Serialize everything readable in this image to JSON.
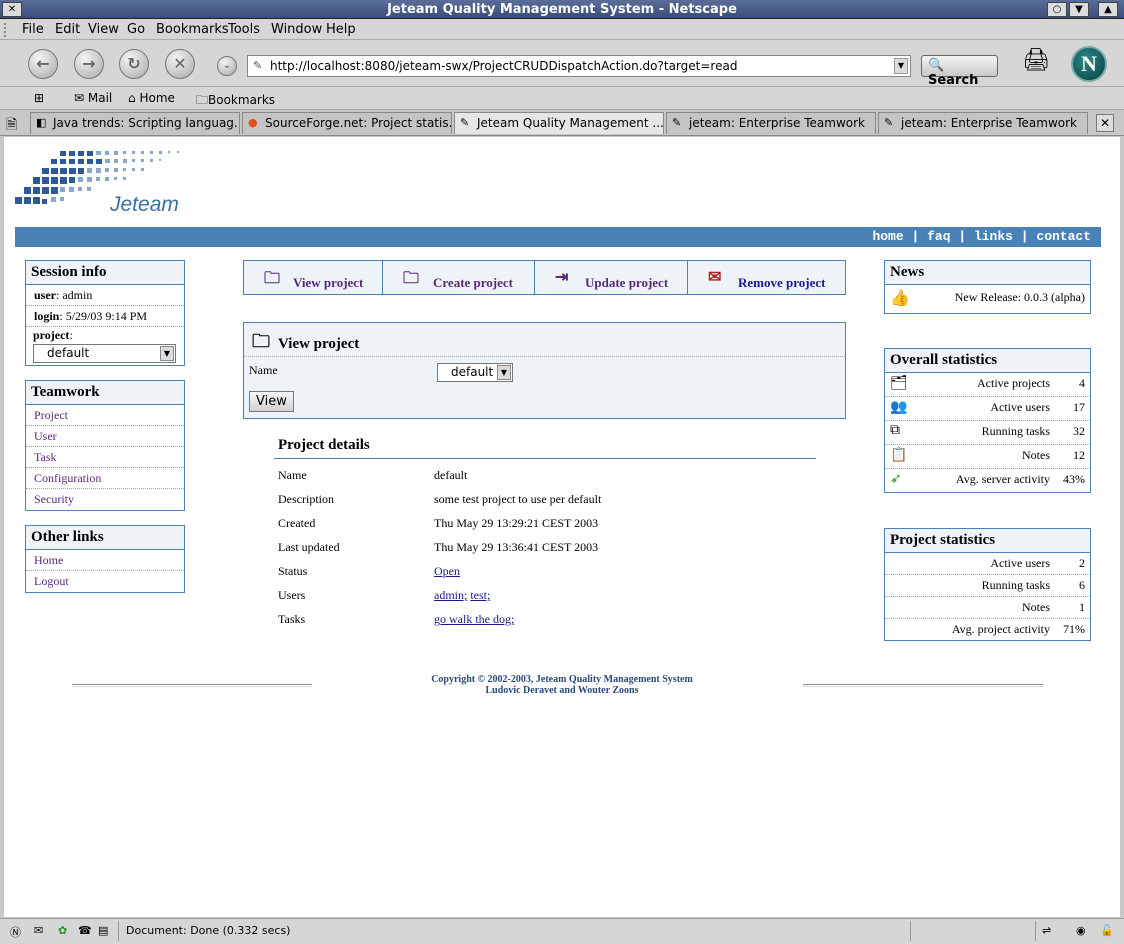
{
  "window": {
    "title": "Jeteam Quality Management System - Netscape"
  },
  "menu": [
    "File",
    "Edit",
    "View",
    "Go",
    "Bookmarks",
    "Tools",
    "Window",
    "Help"
  ],
  "navbar": {
    "url": "http://localhost:8080/jeteam-swx/ProjectCRUDDispatchAction.do?target=read",
    "search_label": "Search"
  },
  "personal_bar": {
    "mail": "Mail",
    "home": "Home",
    "bookmarks": "Bookmarks"
  },
  "tabs": [
    {
      "label": "Java trends: Scripting languag...",
      "active": false
    },
    {
      "label": "SourceForge.net: Project statis...",
      "active": false
    },
    {
      "label": "Jeteam Quality Management ...",
      "active": true
    },
    {
      "label": "jeteam: Enterprise Teamwork",
      "active": false
    },
    {
      "label": "jeteam: Enterprise Teamwork",
      "active": false
    }
  ],
  "logo": {
    "brand": "Jeteam"
  },
  "topnav": {
    "home": "home",
    "faq": "faq",
    "links": "links",
    "contact": "contact",
    "sep": "|"
  },
  "session": {
    "title": "Session info",
    "user_label": "user",
    "user_value": "admin",
    "login_label": "login",
    "login_value": "5/29/03 9:14 PM",
    "project_label": "project",
    "project_value": "default"
  },
  "teamwork": {
    "title": "Teamwork",
    "items": [
      "Project",
      "User",
      "Task",
      "Configuration",
      "Security"
    ]
  },
  "other_links": {
    "title": "Other links",
    "items": [
      "Home",
      "Logout"
    ]
  },
  "actions": [
    "View project",
    "Create project",
    "Update project",
    "Remove project"
  ],
  "view_project": {
    "title": "View project",
    "name_label": "Name",
    "name_value": "default",
    "button": "View"
  },
  "details": {
    "title": "Project details",
    "rows": [
      {
        "label": "Name",
        "value": "default"
      },
      {
        "label": "Description",
        "value": "some test project to use per default"
      },
      {
        "label": "Created",
        "value": "Thu May 29 13:29:21 CEST 2003"
      },
      {
        "label": "Last updated",
        "value": "Thu May 29 13:36:41 CEST 2003"
      },
      {
        "label": "Status",
        "value": "Open"
      },
      {
        "label": "Users",
        "links": [
          "admin;",
          "test;"
        ]
      },
      {
        "label": "Tasks",
        "value": "go walk the dog;"
      }
    ]
  },
  "news": {
    "title": "News",
    "item": "New Release: 0.0.3 (alpha)"
  },
  "overall_stats": {
    "title": "Overall statistics",
    "rows": [
      {
        "label": "Active projects",
        "value": "4"
      },
      {
        "label": "Active users",
        "value": "17"
      },
      {
        "label": "Running tasks",
        "value": "32"
      },
      {
        "label": "Notes",
        "value": "12"
      },
      {
        "label": "Avg. server activity",
        "value": "43%"
      }
    ]
  },
  "project_stats": {
    "title": "Project statistics",
    "rows": [
      {
        "label": "Active users",
        "value": "2"
      },
      {
        "label": "Running tasks",
        "value": "6"
      },
      {
        "label": "Notes",
        "value": "1"
      },
      {
        "label": "Avg. project activity",
        "value": "71%"
      }
    ]
  },
  "footer": {
    "line1": "Copyright © 2002-2003, Jeteam Quality Management System",
    "line2": "Ludovic Deravet and Wouter Zoons"
  },
  "status": {
    "text": "Document: Done (0.332 secs)"
  }
}
